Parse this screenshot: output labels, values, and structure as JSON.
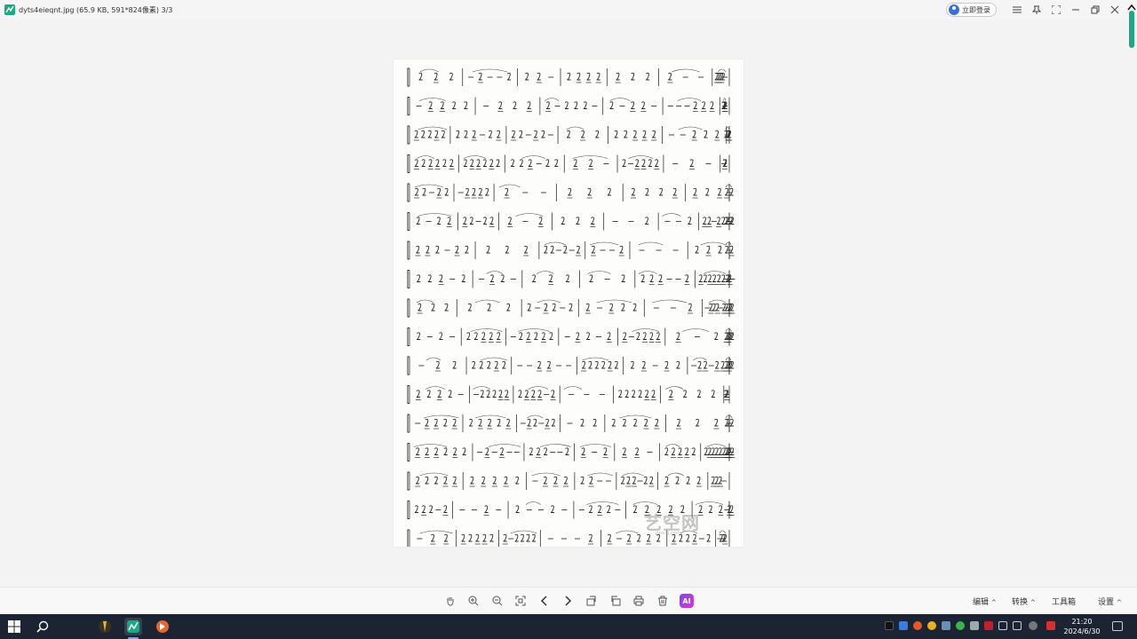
{
  "window": {
    "file_title": "dyts4eieqnt.jpg  (65.9 KB, 591*824像素)  3/3",
    "login_label": "立即登录",
    "accent": "#1aa985"
  },
  "watermark": {
    "text": "艺空网",
    "sub": "yikong.com"
  },
  "bottom_toolbar": {
    "tools": [
      "hand-icon",
      "zoom-in-icon",
      "zoom-out-icon",
      "fit-screen-icon",
      "previous-icon",
      "next-icon",
      "rotate-left-icon",
      "rotate-right-icon",
      "print-icon",
      "delete-icon",
      "ai-icon"
    ],
    "ai_label": "AI",
    "edit_label": "编辑",
    "convert_label": "转换",
    "toolbox_label": "工具箱",
    "settings_label": "设置"
  },
  "taskbar": {
    "time": "21:20",
    "date": "2024/6/30"
  }
}
